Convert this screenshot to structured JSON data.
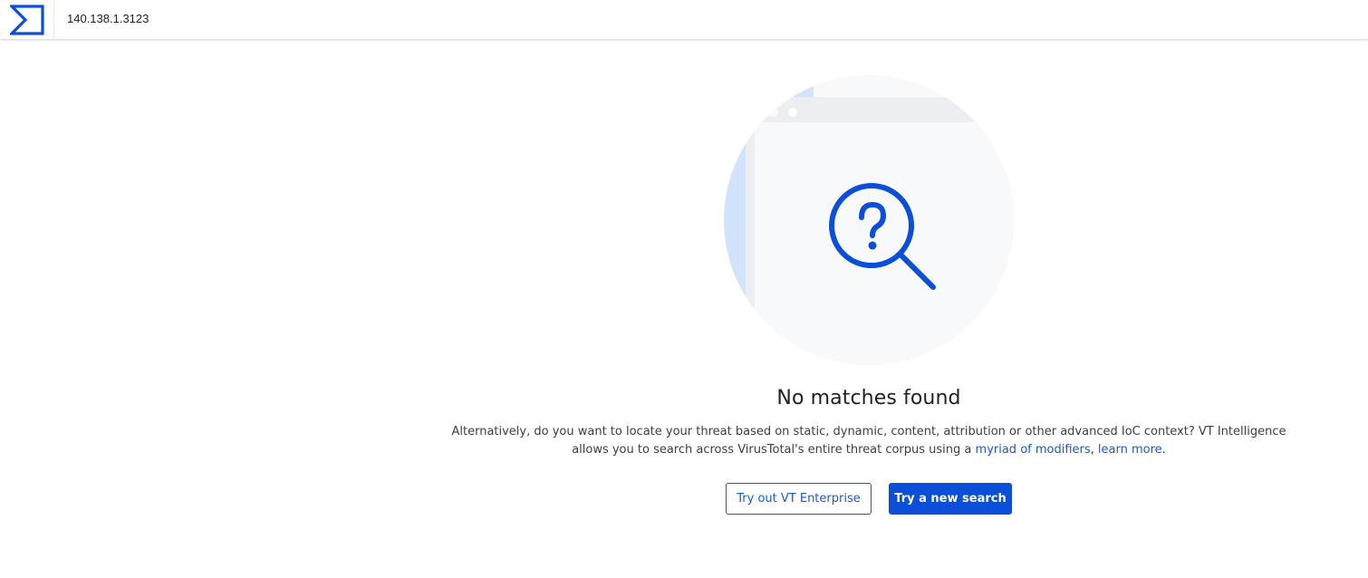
{
  "header": {
    "logo_icon": "virustotal-sigma-logo-icon",
    "search_value": "140.138.1.3123"
  },
  "main": {
    "illustration_icon": "magnifier-question-icon",
    "title": "No matches found",
    "description_part1": "Alternatively, do you want to locate your threat based on static, dynamic, content, attribution or other advanced IoC context? VT Intelligence allows you to search across VirusTotal's entire threat corpus using a ",
    "link_modifiers": "myriad of modifiers",
    "description_sep": ", ",
    "link_learn_more": "learn more",
    "description_end": ".",
    "btn_enterprise": "Try out VT Enterprise",
    "btn_new_search": "Try a new search"
  },
  "colors": {
    "accent": "#0b4fd9",
    "link": "#1a56db",
    "illustration_circle": "#f8f9fa",
    "illustration_backdrop": "#d2e3fc"
  }
}
